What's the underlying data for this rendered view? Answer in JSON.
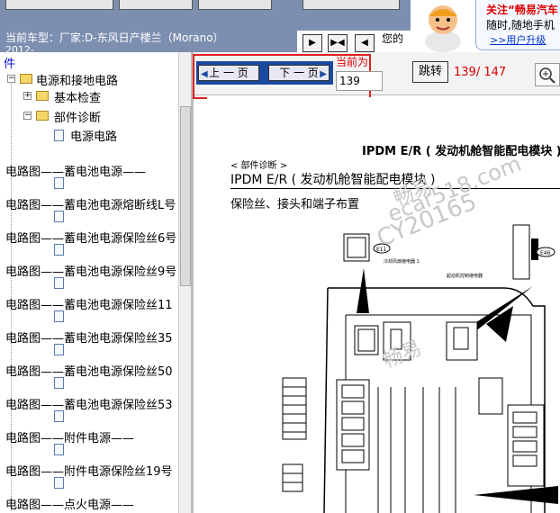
{
  "toolbar": {
    "buttons": [
      "",
      "",
      "",
      ""
    ]
  },
  "car_bar": {
    "label": "当前车型：",
    "value": "厂家:D-东风日产楼兰（Morano）",
    "year": "2012-",
    "your_text": "您的"
  },
  "ad": {
    "line1": "关注“畅易汽车",
    "line2": "随时,随地手机",
    "link": ">>用户升级"
  },
  "tree": {
    "top_label": "件",
    "root": "电源和接地电路",
    "basic": "基本检查",
    "diag": "部件诊断",
    "power": "电源电路",
    "items": [
      "电路图——蓄电池电源——",
      "电路图——蓄电池电源熔断线L号",
      "电路图——蓄电池电源保险丝6号",
      "电路图——蓄电池电源保险丝9号",
      "电路图——蓄电池电源保险丝11",
      "电路图——蓄电池电源保险丝35",
      "电路图——蓄电池电源保险丝50",
      "电路图——蓄电池电源保险丝53",
      "电路图——附件电源——",
      "电路图——附件电源保险丝19号",
      "电路图——点火电源——"
    ]
  },
  "viewer": {
    "prev": "上 一 页",
    "next": "下 一 页",
    "current_label": "当前为",
    "page_value": "139",
    "jump": "跳转",
    "page_count": "139/ 147"
  },
  "document": {
    "title": "IPDM E/R ( 发动机舱智能配电模块 )",
    "section": "< 部件诊断 >",
    "heading": "IPDM E/R ( 发动机舱智能配电模块 )",
    "sub": "保险丝、接头和端子布置",
    "label_a": "冷却风扇继电器 1",
    "label_b": "起动机控制继电器",
    "conn_a": "E11",
    "conn_b": "E46",
    "watermark1": "畅易",
    "watermark2": "ecar518.com",
    "watermark3": "CY20165"
  },
  "colors": {
    "toolbar": "#7d8fb0",
    "accent": "#1a4aa0",
    "highlight": "#e02020"
  }
}
